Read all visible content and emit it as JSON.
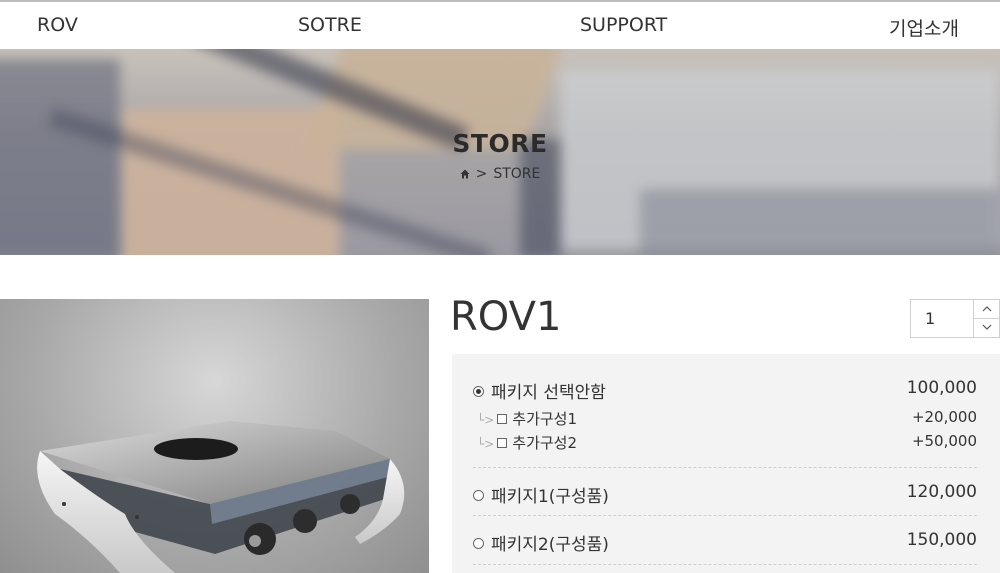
{
  "nav": {
    "rov": "ROV",
    "store": "SOTRE",
    "support": "SUPPORT",
    "about": "기업소개"
  },
  "hero": {
    "title": "STORE",
    "breadcrumb_current": "STORE",
    "separator": ">"
  },
  "product": {
    "name": "ROV1",
    "quantity": "1",
    "options": [
      {
        "label": "패키지 선택안함",
        "price": "100,000",
        "selected": true
      },
      {
        "label": "패키지1(구성품)",
        "price": "120,000",
        "selected": false
      },
      {
        "label": "패키지2(구성품)",
        "price": "150,000",
        "selected": false
      }
    ],
    "addons": [
      {
        "label": "추가구성1",
        "price": "+20,000"
      },
      {
        "label": "추가구성2",
        "price": "+50,000"
      }
    ]
  },
  "icons": {
    "home": "home-icon",
    "up": "chevron-up-icon",
    "down": "chevron-down-icon"
  }
}
